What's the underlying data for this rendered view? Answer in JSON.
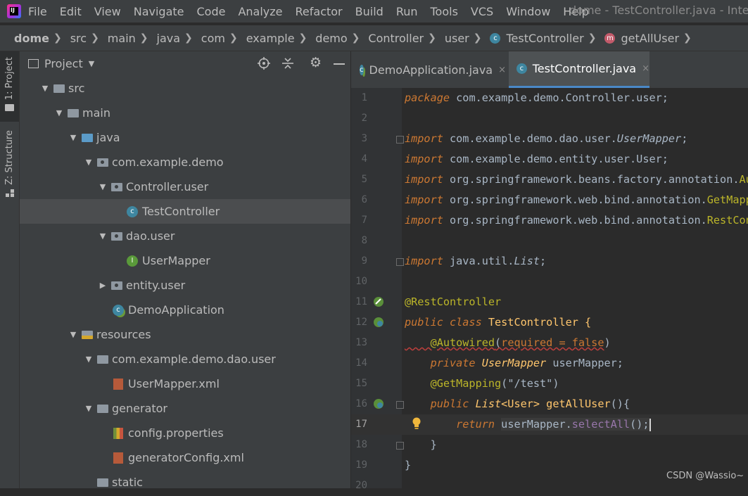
{
  "menubar": {
    "items": [
      "File",
      "Edit",
      "View",
      "Navigate",
      "Code",
      "Analyze",
      "Refactor",
      "Build",
      "Run",
      "Tools",
      "VCS",
      "Window",
      "Help"
    ],
    "title": "dome - TestController.java - IntelliJ"
  },
  "breadcrumb": [
    "dome",
    "src",
    "main",
    "java",
    "com",
    "example",
    "demo",
    "Controller",
    "user",
    "TestController",
    "getAllUser"
  ],
  "side_tabs": {
    "project": "1: Project",
    "structure": "Z: Structure"
  },
  "project": {
    "header": "Project",
    "tree": [
      {
        "label": "src",
        "icon": "folder-icon",
        "arrow": "▼"
      },
      {
        "label": "main",
        "icon": "folder-icon",
        "arrow": "▼"
      },
      {
        "label": "java",
        "icon": "source-folder-icon",
        "arrow": "▼"
      },
      {
        "label": "com.example.demo",
        "icon": "package-icon",
        "arrow": "▼"
      },
      {
        "label": "Controller.user",
        "icon": "package-icon",
        "arrow": "▼"
      },
      {
        "label": "TestController",
        "icon": "class-icon",
        "arrow": ""
      },
      {
        "label": "dao.user",
        "icon": "package-icon",
        "arrow": "▼"
      },
      {
        "label": "UserMapper",
        "icon": "interface-icon",
        "arrow": ""
      },
      {
        "label": "entity.user",
        "icon": "package-icon",
        "arrow": "▶"
      },
      {
        "label": "DemoApplication",
        "icon": "spring-boot-class-icon",
        "arrow": ""
      },
      {
        "label": "resources",
        "icon": "resources-folder-icon",
        "arrow": "▼"
      },
      {
        "label": "com.example.demo.dao.user",
        "icon": "folder-icon",
        "arrow": "▼"
      },
      {
        "label": "UserMapper.xml",
        "icon": "xml-file-icon",
        "arrow": ""
      },
      {
        "label": "generator",
        "icon": "folder-icon",
        "arrow": "▼"
      },
      {
        "label": "config.properties",
        "icon": "properties-file-icon",
        "arrow": ""
      },
      {
        "label": "generatorConfig.xml",
        "icon": "xml-file-icon",
        "arrow": ""
      },
      {
        "label": "static",
        "icon": "folder-icon",
        "arrow": ""
      }
    ]
  },
  "tabs": [
    {
      "label": "DemoApplication.java",
      "close": "×"
    },
    {
      "label": "TestController.java",
      "close": "×"
    }
  ],
  "editor": {
    "line_numbers": [
      "1",
      "2",
      "3",
      "4",
      "5",
      "6",
      "7",
      "8",
      "9",
      "10",
      "11",
      "12",
      "13",
      "14",
      "15",
      "16",
      "17",
      "18",
      "19",
      "20"
    ],
    "t1a": "package",
    "t1b": " com.example.demo.Controller.user;",
    "t3a": "import",
    "t3b": " com.example.demo.dao.user.",
    "t3c": "UserMapper",
    "t3d": ";",
    "t4a": "import",
    "t4b": " com.example.demo.entity.user.User;",
    "t5a": "import",
    "t5b": " org.springframework.beans.factory.annotation.",
    "t5c": "Aut",
    "t6a": "import",
    "t6b": " org.springframework.web.bind.annotation.",
    "t6c": "GetMapp",
    "t7a": "import",
    "t7b": " org.springframework.web.bind.annotation.",
    "t7c": "RestCont",
    "t9a": "import",
    "t9b": " java.util.",
    "t9c": "List",
    "t9d": ";",
    "t11": "@RestController",
    "t12a": "public class",
    "t12b": " TestController {",
    "t13a": "    @Autowired",
    "t13b": "(",
    "t13c": "required = false",
    "t13d": ")",
    "t14a": "    private",
    "t14b": " UserMapper",
    "t14c": " userMapper;",
    "t15a": "    @GetMapping",
    "t15b": "(",
    "t15c": "\"/test\"",
    "t15d": ")",
    "t16a": "    public",
    "t16b": " List",
    "t16c": "<User>",
    "t16d": " getAllUser",
    "t16e": "(){",
    "t17a": "        return",
    "t17b": " ",
    "t17c": "userMapper.",
    "t17d": "selectAll",
    "t17e": "();",
    "t18": "    }",
    "t19": "}"
  },
  "watermark": "CSDN @Wassio~",
  "colors": {
    "keyword": "#cc7832",
    "annotation": "#bbb529",
    "string": "#6a8759",
    "method": "#ffc66d",
    "text": "#a9b7c6",
    "accent": "#4a88c7"
  }
}
